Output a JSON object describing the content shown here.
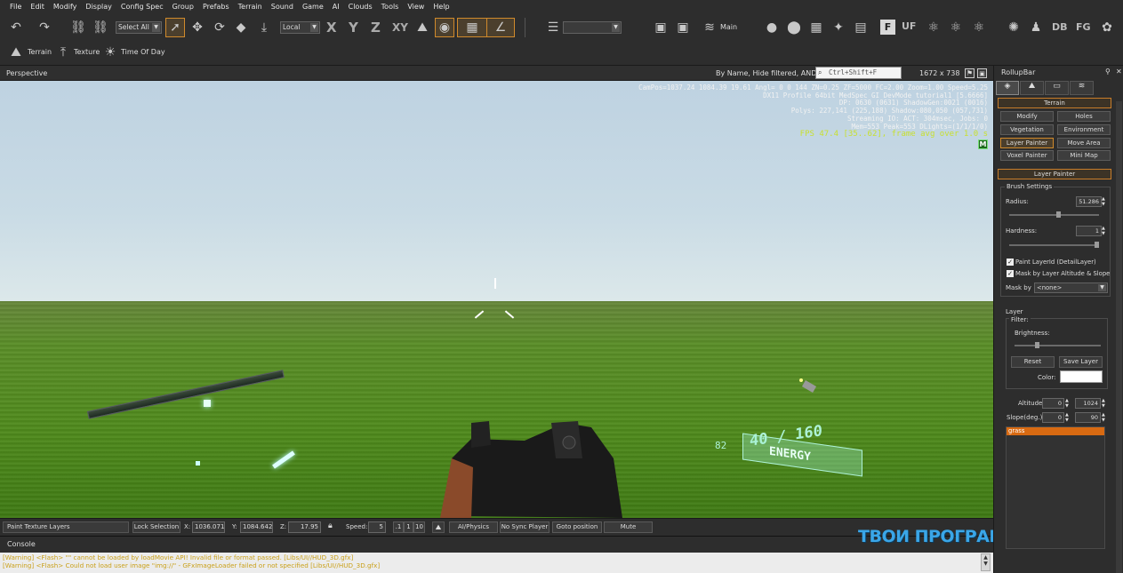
{
  "menu": [
    "File",
    "Edit",
    "Modify",
    "Display",
    "Config Spec",
    "Group",
    "Prefabs",
    "Terrain",
    "Sound",
    "Game",
    "AI",
    "Clouds",
    "Tools",
    "View",
    "Help"
  ],
  "toolbar": {
    "select_all": "Select All",
    "coord_system": "Local",
    "axis_x": "X",
    "axis_y": "Y",
    "axis_z": "Z",
    "axis_xy": "XY",
    "layer_name": "Main",
    "text_f": "F",
    "text_uf": "UF",
    "text_db": "DB",
    "text_fg": "FG",
    "terrain_label": "Terrain",
    "texture_label": "Texture",
    "time_of_day_label": "Time Of Day"
  },
  "viewport": {
    "title": "Perspective",
    "filter_text": "By Name, Hide filtered, AND",
    "search_value": "Ctrl+Shift+F",
    "resolution": "1672 x 738",
    "debug_lines": [
      "CamPos=1037.24 1084.39 19.61 Angl=  0  0 144 ZN=0.25 ZF=5000 FC=2.00 Zoom=1.00 Speed=5.25",
      "DX11 Profile 64bit MedSpec GI DevMode tutorial1 [5.6666]",
      "DP: 0630 (0631) ShadowGen:0021 (0016)",
      "Polys: 227,141 (225,188) Shadow:080,050 (057,731)",
      "Streaming IO: ACT: 304msec, Jobs: 0",
      "Mem=553 Peak=553 DLights=(1/1/1/0)"
    ],
    "fps_line": "FPS 47.4 [35..62], frame avg over 1.0 s",
    "m_badge": "M",
    "hud": {
      "ammo": "40 / 160",
      "small_num": "82",
      "energy_label": "ENERGY"
    }
  },
  "statusbar": {
    "mode": "Paint Texture Layers",
    "lock_selection": "Lock Selection",
    "x_label": "X:",
    "x_value": "1036.071",
    "y_label": "Y:",
    "y_value": "1084.642",
    "z_label": "Z:",
    "z_value": "17.95",
    "speed_label": "Speed:",
    "speed_value": "5",
    "speed_opts": [
      ".1",
      "1",
      "10"
    ],
    "ai_physics": "AI/Physics",
    "no_sync_player": "No Sync Player",
    "goto_position": "Goto position",
    "mute": "Mute"
  },
  "console": {
    "title": "Console",
    "lines": [
      "[Warning] <Flash> \"\" cannot be loaded by loadMovie API! Invalid file or format passed. [Libs/UI//HUD_3D.gfx]",
      "[Warning] <Flash> Could not load user image \"img://\" - GFxImageLoader failed or not specified [Libs/UI//HUD_3D.gfx]"
    ]
  },
  "rollup": {
    "title": "RollupBar",
    "terrain_header": "Terrain",
    "buttons": [
      "Modify",
      "Holes",
      "Vegetation",
      "Environment",
      "Layer Painter",
      "Move Area",
      "Voxel Painter",
      "Mini Map"
    ],
    "layer_painter_header": "Layer Painter",
    "brush_settings": "Brush Settings",
    "radius_label": "Radius:",
    "radius_value": "51.286",
    "radius_fraction": 0.55,
    "hardness_label": "Hardness:",
    "hardness_value": "1",
    "hardness_fraction": 1.0,
    "paint_layerid": "Paint LayerId (DetailLayer)",
    "mask_by_layer": "Mask by Layer Altitude & Slope",
    "mask_by_label": "Mask by",
    "mask_by_value": "<none>",
    "layer_group": "Layer",
    "filter_label": "Filter:",
    "brightness_label": "Brightness:",
    "brightness_fraction": 0.25,
    "reset": "Reset",
    "save_layer": "Save Layer",
    "color_label": "Color:",
    "altitude_label": "Altitude",
    "altitude_min": "0",
    "altitude_max": "1024",
    "slope_label": "Slope(deg.)",
    "slope_min": "0",
    "slope_max": "90",
    "layers": [
      "grass"
    ]
  },
  "watermark": "ТВОИ ПРОГРАММЫ РУ",
  "colors": {
    "accent": "#d08a2c",
    "layer_selected": "#d86a12",
    "fps_text": "#c8e030",
    "hud": "#aef2d8"
  }
}
